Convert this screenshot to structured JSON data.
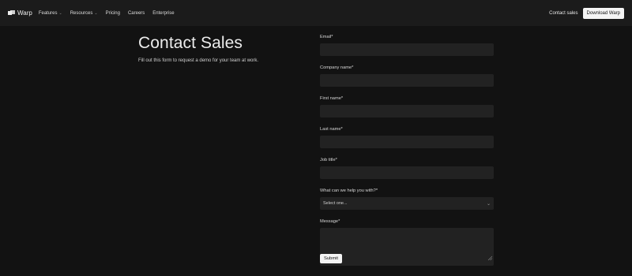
{
  "nav": {
    "logo_text": "Warp",
    "items": [
      {
        "label": "Features",
        "has_dropdown": true
      },
      {
        "label": "Resources",
        "has_dropdown": true
      },
      {
        "label": "Pricing",
        "has_dropdown": false
      },
      {
        "label": "Careers",
        "has_dropdown": false
      },
      {
        "label": "Enterprise",
        "has_dropdown": false
      }
    ],
    "contact_sales": "Contact sales",
    "download": "Download Warp"
  },
  "hero": {
    "title": "Contact Sales",
    "subtitle": "Fill out this form to request a demo for your team at work."
  },
  "form": {
    "fields": [
      {
        "label": "Email*",
        "value": ""
      },
      {
        "label": "Company name*",
        "value": ""
      },
      {
        "label": "First name*",
        "value": ""
      },
      {
        "label": "Last name*",
        "value": ""
      },
      {
        "label": "Job title*",
        "value": ""
      }
    ],
    "help_select": {
      "label": "What can we help you with?*",
      "selected": "Select one..."
    },
    "message": {
      "label": "Message*",
      "value": ""
    },
    "submit": "Submit"
  },
  "colors": {
    "background": "#121212",
    "nav_background": "#1b1b1b",
    "input_background": "#222222",
    "button_background": "#f4f4f4"
  },
  "icons": {
    "logo": "warp-logo-icon",
    "dropdown": "chevron-down-icon",
    "resize": "resize-handle-icon"
  }
}
